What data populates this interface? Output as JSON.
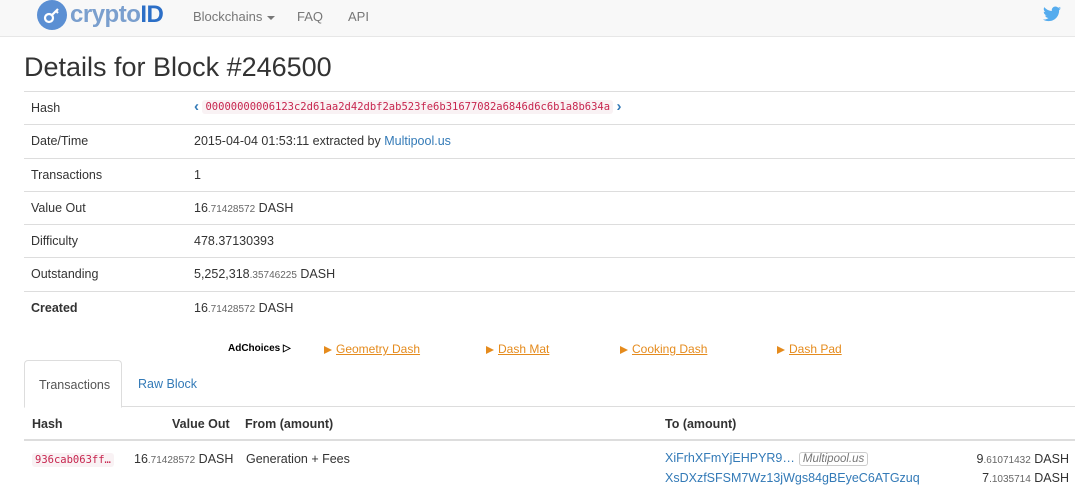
{
  "navbar": {
    "logo_text_light": "crypto",
    "logo_text_bold": "ID",
    "items": [
      {
        "label": "Blockchains"
      },
      {
        "label": "FAQ"
      },
      {
        "label": "API"
      }
    ]
  },
  "page": {
    "title": "Details for Block #246500"
  },
  "details": {
    "hash": {
      "label": "Hash",
      "value": "00000000006123c2d61aa2d42dbf2ab523fe6b31677082a6846d6c6b1a8b634a"
    },
    "datetime": {
      "label": "Date/Time",
      "value": "2015-04-04 01:53:11",
      "extracted_by": "extracted by",
      "pool": "Multipool.us"
    },
    "transactions": {
      "label": "Transactions",
      "value": "1"
    },
    "value_out": {
      "label": "Value Out",
      "int": "16",
      "frac": ".71428572",
      "unit": "DASH"
    },
    "difficulty": {
      "label": "Difficulty",
      "value": "478.37130393"
    },
    "outstanding": {
      "label": "Outstanding",
      "int": "5,252,318",
      "frac": ".35746225",
      "unit": "DASH"
    },
    "created": {
      "label": "Created",
      "int": "16",
      "frac": ".71428572",
      "unit": "DASH"
    }
  },
  "ads": {
    "adchoices": "AdChoices",
    "links": [
      "Geometry Dash",
      "Dash Mat",
      "Cooking Dash",
      "Dash Pad"
    ]
  },
  "tabs": [
    {
      "label": "Transactions"
    },
    {
      "label": "Raw Block"
    }
  ],
  "tx_table": {
    "headers": {
      "hash": "Hash",
      "value_out": "Value Out",
      "from": "From (amount)",
      "to": "To (amount)"
    },
    "row": {
      "hash": "936cab063ff…",
      "value_int": "16",
      "value_frac": ".71428572",
      "value_unit": "DASH",
      "from": "Generation + Fees",
      "outputs": [
        {
          "address": "XiFrhXFmYjEHPYR9…",
          "tag": "Multipool.us",
          "amount_int": "9",
          "amount_frac": ".61071432",
          "unit": "DASH"
        },
        {
          "address": "XsDXzfSFSM7Wz13jWgs84gBEyeC6ATGzuq",
          "tag": "",
          "amount_int": "7",
          "amount_frac": ".1035714",
          "unit": "DASH"
        }
      ]
    }
  },
  "colors": {
    "link": "#337ab7",
    "code": "#c7254e",
    "ad": "#e58b1d",
    "twitter": "#55acee"
  }
}
